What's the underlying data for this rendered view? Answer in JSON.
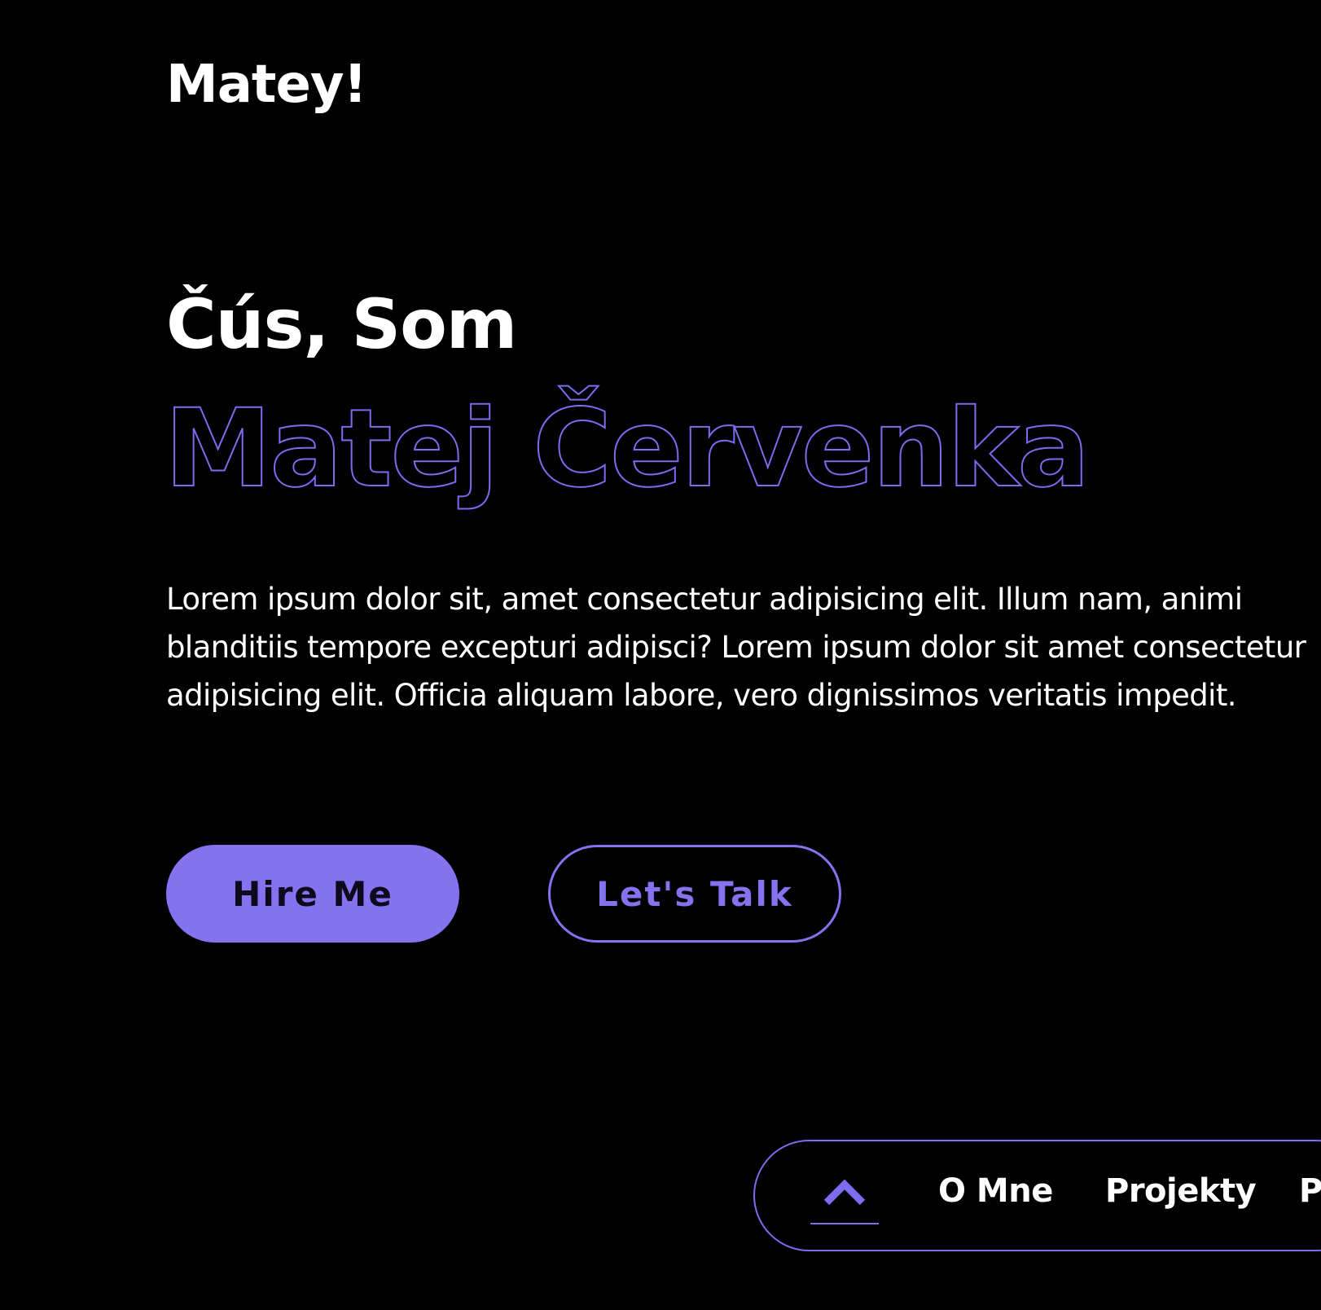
{
  "header": {
    "logo": "Matey!"
  },
  "hero": {
    "greeting": "Čús, Som",
    "name": "Matej Červenka",
    "intro": "Lorem ipsum dolor sit, amet consectetur adipisicing elit. Illum nam, animi blanditiis tempore excepturi adipisci? Lorem ipsum dolor sit amet consectetur adipisicing elit. Officia aliquam labore, vero dignissimos veritatis impedit.",
    "buttons": {
      "hire": "Hire Me",
      "talk": "Let's Talk"
    }
  },
  "nav": {
    "up_icon": "chevron-up-icon",
    "items": [
      {
        "label": "O Mne"
      },
      {
        "label": "Projekty"
      },
      {
        "label": "P"
      }
    ]
  },
  "colors": {
    "background": "#000000",
    "accent": "#8472ef",
    "text": "#ffffff"
  }
}
